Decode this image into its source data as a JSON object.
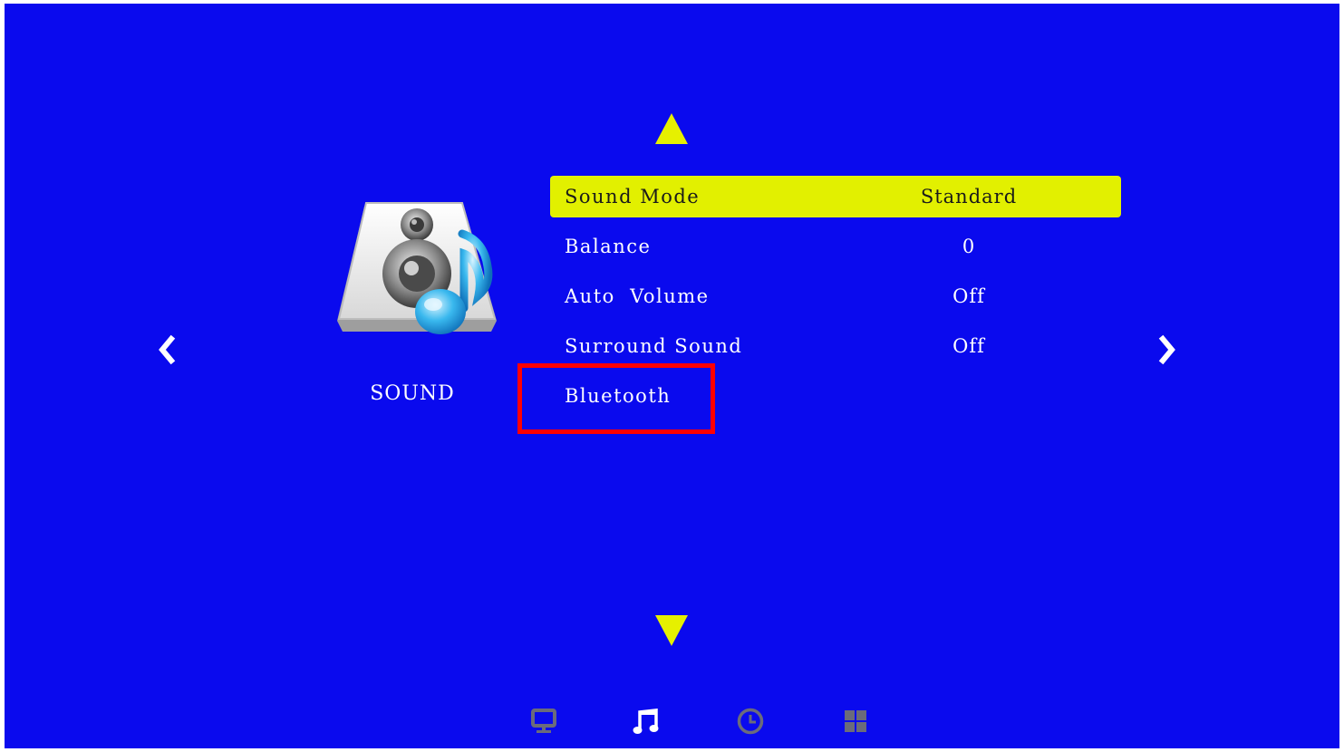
{
  "category": {
    "label": "SOUND",
    "icon": "speaker-music-icon"
  },
  "navigation": {
    "up_icon": "arrow-up-icon",
    "down_icon": "arrow-down-icon",
    "left_icon": "chevron-left-icon",
    "right_icon": "chevron-right-icon"
  },
  "menu": {
    "items": [
      {
        "label": "Sound Mode",
        "value": "Standard",
        "selected": true
      },
      {
        "label": "Balance",
        "value": "0",
        "selected": false
      },
      {
        "label": "Auto  Volume",
        "value": "Off",
        "selected": false
      },
      {
        "label": "Surround Sound",
        "value": "Off",
        "selected": false
      },
      {
        "label": "Bluetooth",
        "value": "",
        "selected": false
      }
    ]
  },
  "bottom_bar": {
    "icons": [
      "monitor-icon",
      "music-note-icon",
      "clock-icon",
      "grid-icon"
    ],
    "active": "music-note-icon"
  },
  "colors": {
    "background": "#0a0aee",
    "accent": "#e2f000",
    "highlight_box": "#ff0000",
    "inactive_icon": "#6b6b7b"
  }
}
